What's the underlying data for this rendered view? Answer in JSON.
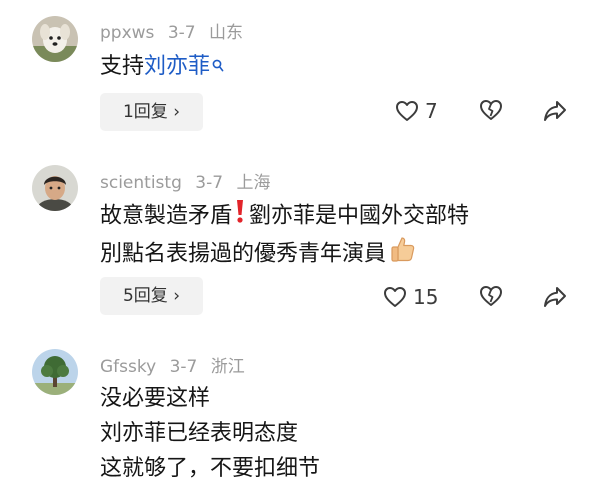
{
  "comments": [
    {
      "username": "ppxws",
      "date": "3-7",
      "location": "山东",
      "text_prefix": "支持",
      "link_text": "刘亦菲",
      "reply_label": "1回复 ›",
      "like_count": "7",
      "avatar": "dog-avatar"
    },
    {
      "username": "scientistg",
      "date": "3-7",
      "location": "上海",
      "lines": [
        "故意製造矛盾",
        "劉亦菲是中國外交部特",
        "別點名表揚過的優秀青年演員"
      ],
      "emoji": [
        "red-exclamation-icon",
        "thumbs-up-icon"
      ],
      "reply_label": "5回复 ›",
      "like_count": "15",
      "avatar": "man-avatar"
    },
    {
      "username": "Gfssky",
      "date": "3-7",
      "location": "浙江",
      "lines": [
        "没必要这样",
        "刘亦菲已经表明态度",
        "这就够了，不要扣细节"
      ],
      "avatar": "tree-avatar"
    }
  ],
  "colors": {
    "meta": "#9b9b9b",
    "text": "#161616",
    "link": "#1e5cc6",
    "reply_bg": "#f2f2f2",
    "icon": "#3c3c3c"
  }
}
